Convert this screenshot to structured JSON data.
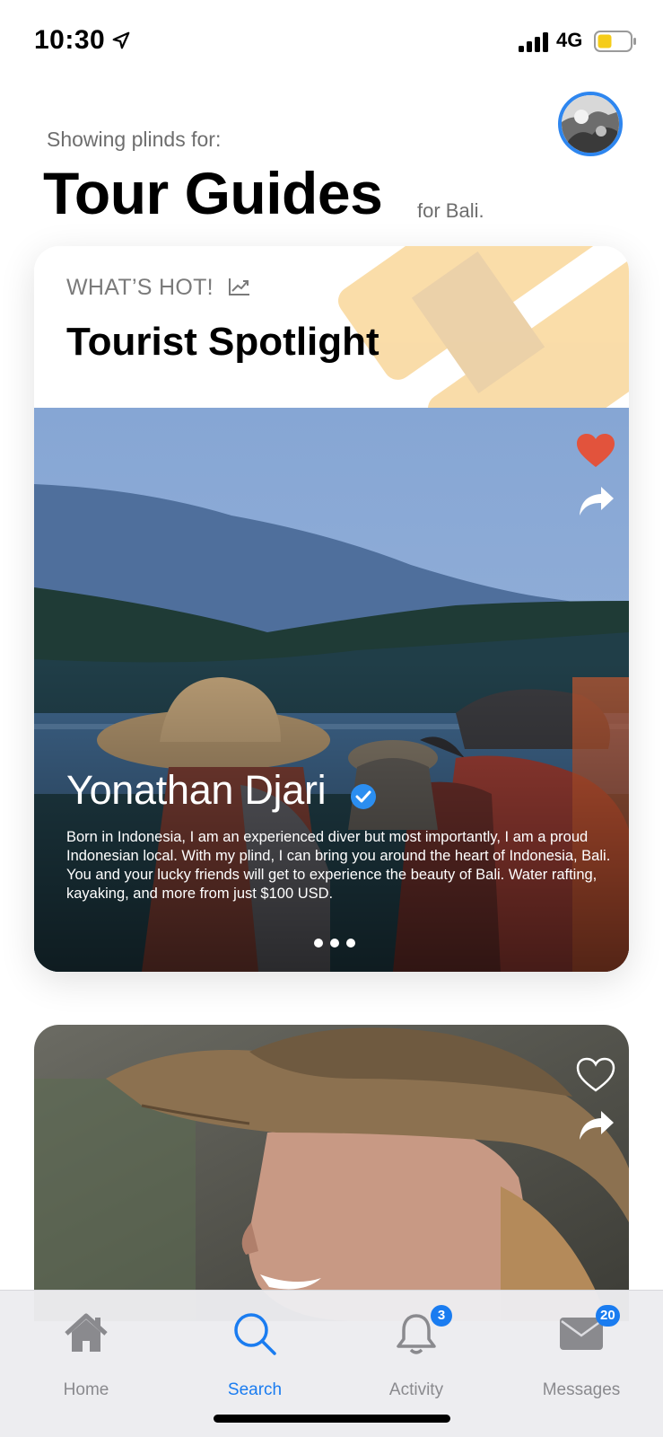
{
  "status_bar": {
    "time": "10:30",
    "network": "4G",
    "battery_color": "#f5cc19",
    "icons": [
      "location-arrow-icon",
      "signal-icon",
      "battery-icon"
    ]
  },
  "header": {
    "subheading": "Showing plinds for:",
    "title": "Tour Guides",
    "title_suffix": "for Bali."
  },
  "spotlight_card": {
    "label": "WHAT’S HOT!",
    "label_icon": "trending-up-icon",
    "title": "Tourist Spotlight",
    "guide_name": "Yonathan Djari",
    "verified": true,
    "bio": "Born in Indonesia, I am an experienced diver but most importantly, I am a proud Indonesian local. With my plind, I can bring you around the heart of Indonesia, Bali. You and your lucky friends will get to experience the beauty of Bali. Water rafting, kayaking, and more from just $100 USD.",
    "liked": true,
    "heart_color": "#e2533c",
    "carousel_pages": 3
  },
  "second_card": {
    "liked": false
  },
  "tab_bar": {
    "tabs": [
      {
        "label": "Home",
        "icon": "home-icon",
        "active": false
      },
      {
        "label": "Search",
        "icon": "search-icon",
        "active": true
      },
      {
        "label": "Activity",
        "icon": "bell-icon",
        "active": false,
        "badge": "3"
      },
      {
        "label": "Messages",
        "icon": "envelope-icon",
        "active": false,
        "badge": "20"
      }
    ],
    "accent": "#1a7cf0"
  }
}
